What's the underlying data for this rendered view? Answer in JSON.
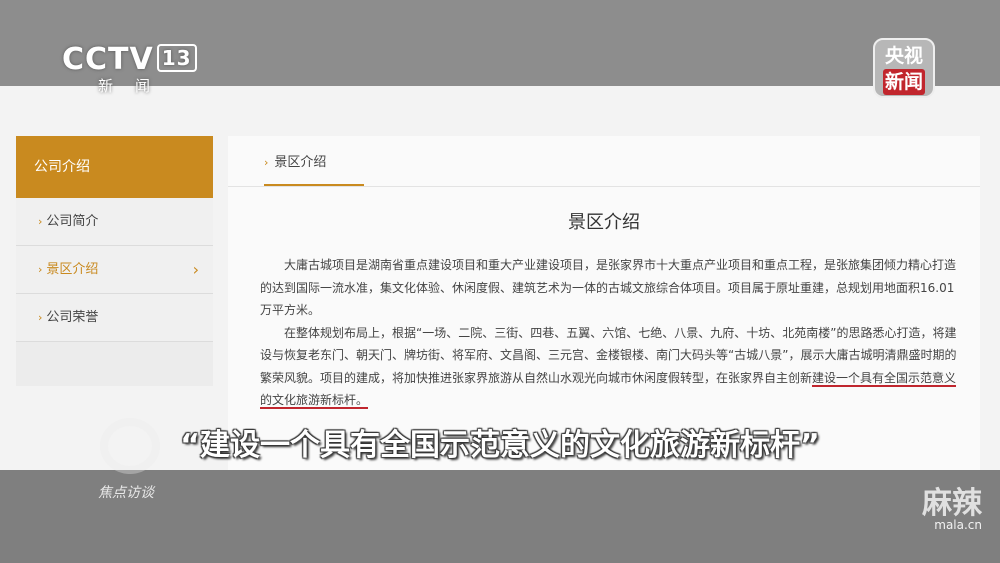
{
  "broadcast": {
    "channel_logo": "CCTV",
    "channel_number": "13",
    "channel_sub": "新闻",
    "corner_logo_line1": "央视",
    "corner_logo_line2": "新闻",
    "subtitle": "“建设一个具有全国示范意义的文化旅游新标杆”",
    "program_name": "焦点访谈",
    "watermark_cn": "麻辣",
    "watermark_url": "mala.cn"
  },
  "sidebar": {
    "header": "公司介绍",
    "items": [
      {
        "label": "公司简介"
      },
      {
        "label": "景区介绍"
      },
      {
        "label": "公司荣誉"
      }
    ]
  },
  "content": {
    "tab_label": "景区介绍",
    "title": "景区介绍",
    "para1": "大庸古城项目是湖南省重点建设项目和重大产业建设项目，是张家界市十大重点产业项目和重点工程，是张旅集团倾力精心打造的达到国际一流水准，集文化体验、休闲度假、建筑艺术为一体的古城文旅综合体项目。项目属于原址重建，总规划用地面积16.01万平方米。",
    "para2_a": "在整体规划布局上，根据“一场、二院、三街、四巷、五翼、六馆、七绝、八景、九府、十坊、北苑南楼”的思路悉心打造，将建设与恢复老东门、朝天门、牌坊街、将军府、文昌阁、三元宫、金楼银楼、南门大码头等“古城八景”，展示大庸古城明清鼎盛时期的繁荣风貌。项目的建成，将加快推进张家界旅游从自然山水观光向城市休闲度假转型，在张家界自主创新",
    "para2_b": "建设一个具有全国示范意义的文化旅游新标杆。"
  }
}
